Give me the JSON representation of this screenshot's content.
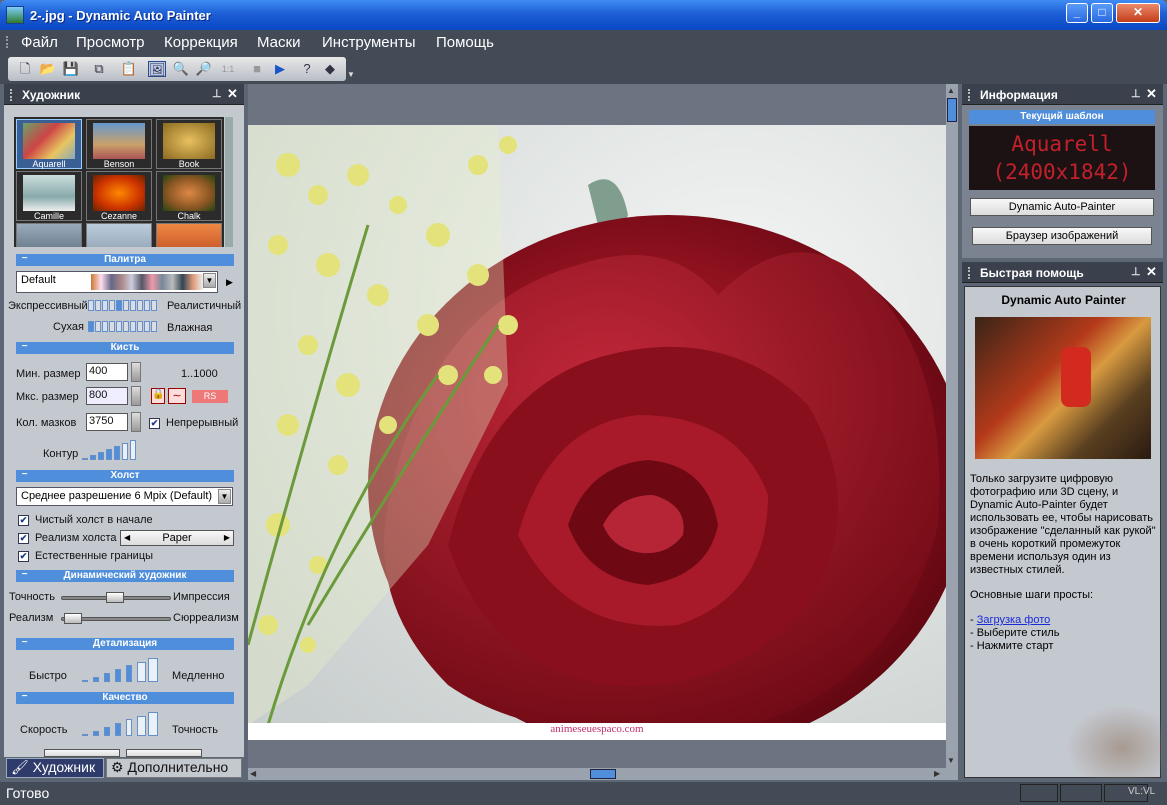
{
  "window": {
    "title": "2-.jpg - Dynamic Auto Painter",
    "minimize": "_",
    "maximize": "□",
    "close": "✕"
  },
  "menu": [
    "Файл",
    "Просмотр",
    "Коррекция",
    "Маски",
    "Инструменты",
    "Помощь"
  ],
  "toolbar": {
    "icons": [
      "new-icon",
      "open-icon",
      "save-icon",
      "save-as-icon",
      "paste-icon",
      "paint-icon",
      "zoom-in-icon",
      "zoom-out-icon",
      "actual-size-icon",
      "stop-icon",
      "play-icon",
      "help-icon",
      "eraser-icon"
    ],
    "actual_size": "1:1"
  },
  "artist_panel": {
    "title": "Художник",
    "styles": [
      "Aquarell",
      "Benson",
      "Book",
      "Camille",
      "Cezanne",
      "Chalk"
    ],
    "palette": {
      "section": "Палитра",
      "value": "Default",
      "left": "Экспрессивный",
      "right": "Реалистичный",
      "left2": "Сухая",
      "right2": "Влажная"
    },
    "brush": {
      "section": "Кисть",
      "min_label": "Мин. размер",
      "min_value": "400",
      "range": "1..1000",
      "max_label": "Мкс. размер",
      "max_value": "800",
      "rs": "RS",
      "count_label": "Кол. мазков",
      "count_value": "3750",
      "continuous": "Непрерывный",
      "contour": "Контур"
    },
    "canvas": {
      "section": "Холст",
      "resolution": "Среднее разрешение 6 Mpix (Default)",
      "clean": "Чистый холст в начале",
      "realism": "Реализм холста",
      "paper": "Paper",
      "borders": "Естественные границы"
    },
    "dynamic": {
      "section": "Динамический художник",
      "accuracy": "Точность",
      "impression": "Импрессия",
      "realism": "Реализм",
      "surrealism": "Сюрреализм"
    },
    "detail": {
      "section": "Детализация",
      "fast": "Быстро",
      "slow": "Медленно"
    },
    "quality": {
      "section": "Качество",
      "speed": "Скорость",
      "accuracy": "Точность"
    },
    "tabs": [
      "Художник",
      "Дополнительно"
    ]
  },
  "info_panel": {
    "title": "Информация",
    "template_label": "Текущий шаблон",
    "led_line1": "Aquarell",
    "led_line2": "(2400x1842)",
    "btn1": "Dynamic Auto-Painter",
    "btn2": "Браузер изображений"
  },
  "help_panel": {
    "title": "Быстрая помощь",
    "heading": "Dynamic Auto Painter",
    "p1": "Только загрузите цифровую фотографию или 3D сцену, и Dynamic Auto-Painter будет использовать ее, чтобы нарисовать изображение \"сделанный как рукой\" в очень короткий промежуток времени используя один из известных стилей.",
    "p2": "Основные шаги просты:",
    "step1": "Загрузка фото",
    "step2": "- Выберите стиль",
    "step3": "- Нажмите старт"
  },
  "image": {
    "watermark": "animeseuespaco.com"
  },
  "status": {
    "text": "Готово",
    "corner_logo": "VL:VL"
  }
}
